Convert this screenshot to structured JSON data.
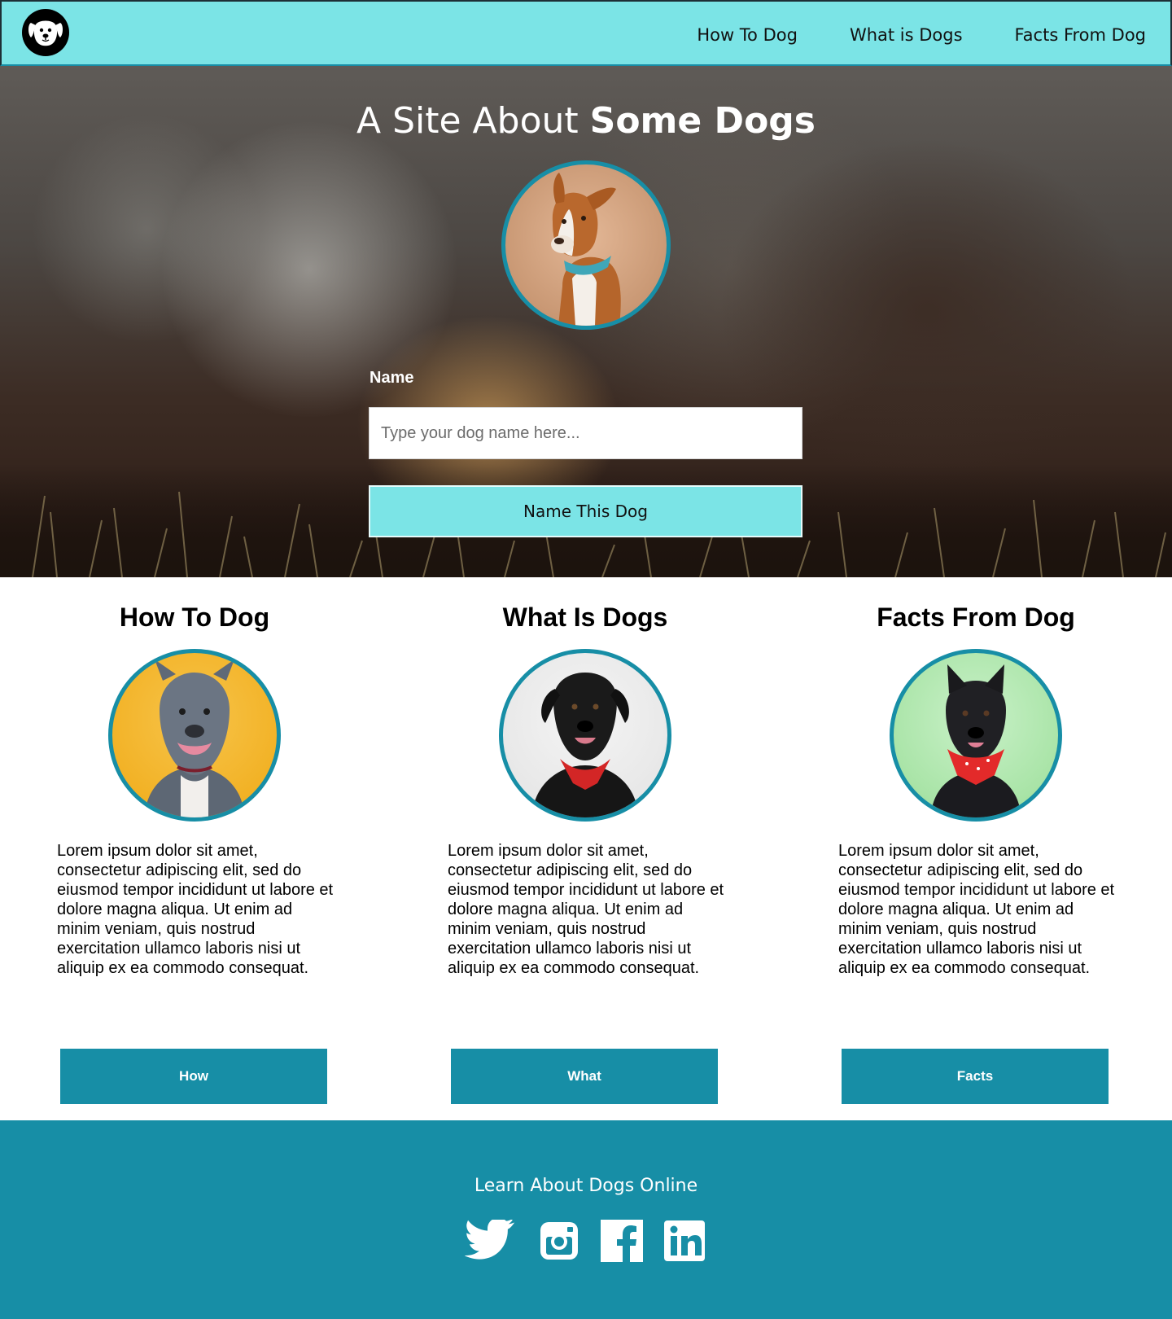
{
  "header": {
    "logo_icon": "dog-face-icon",
    "nav": [
      {
        "label": "How To Dog"
      },
      {
        "label": "What is Dogs"
      },
      {
        "label": "Facts From Dog"
      }
    ]
  },
  "hero": {
    "title_regular": "A Site About ",
    "title_bold": "Some Dogs",
    "name_label": "Name",
    "name_placeholder": "Type your dog name here...",
    "name_value": "",
    "button_label": "Name This Dog"
  },
  "features": [
    {
      "title": "How To Dog",
      "text": "Lorem ipsum dolor sit amet, consectetur adipiscing elit, sed do eiusmod tempor incididunt ut labore et dolore magna aliqua. Ut enim ad minim veniam, quis nostrud exercitation ullamco laboris nisi ut aliquip ex ea commodo consequat.",
      "button": "How"
    },
    {
      "title": "What Is Dogs",
      "text": "Lorem ipsum dolor sit amet, consectetur adipiscing elit, sed do eiusmod tempor incididunt ut labore et dolore magna aliqua. Ut enim ad minim veniam, quis nostrud exercitation ullamco laboris nisi ut aliquip ex ea commodo consequat.",
      "button": "What"
    },
    {
      "title": "Facts From Dog",
      "text": "Lorem ipsum dolor sit amet, consectetur adipiscing elit, sed do eiusmod tempor incididunt ut labore et dolore magna aliqua. Ut enim ad minim veniam, quis nostrud exercitation ullamco laboris nisi ut aliquip ex ea commodo consequat.",
      "button": "Facts"
    }
  ],
  "footer": {
    "text": "Learn About Dogs Online",
    "social": [
      "twitter-icon",
      "instagram-icon",
      "facebook-icon",
      "linkedin-icon"
    ]
  },
  "colors": {
    "nav_bg": "#7be4e6",
    "accent": "#178ea6",
    "text_dark": "#111111"
  }
}
